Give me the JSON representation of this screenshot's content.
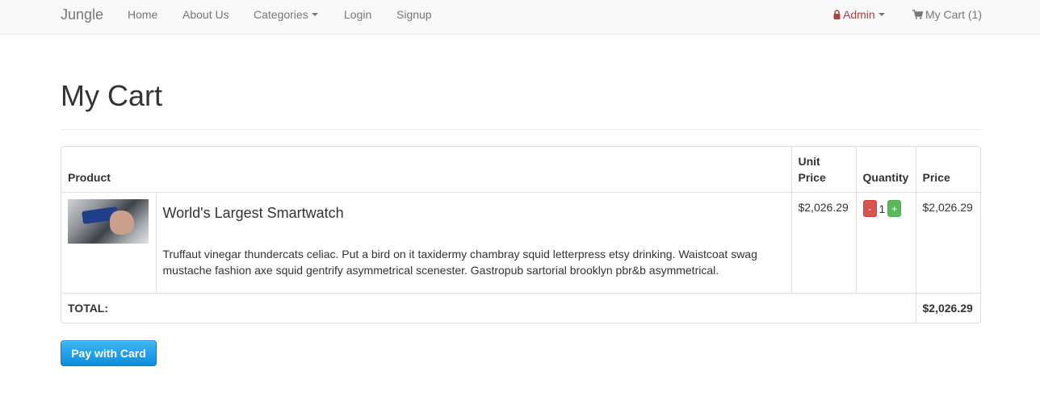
{
  "navbar": {
    "brand": "Jungle",
    "links": {
      "home": "Home",
      "about": "About Us",
      "categories": "Categories",
      "login": "Login",
      "signup": "Signup"
    },
    "admin_label": "Admin",
    "cart_label": "My Cart (1)"
  },
  "page": {
    "title": "My Cart"
  },
  "cart": {
    "headers": {
      "product": "Product",
      "unit_price_line1": "Unit",
      "unit_price_line2": "Price",
      "quantity": "Quantity",
      "price": "Price"
    },
    "items": [
      {
        "name": "World's Largest Smartwatch",
        "description": "Truffaut vinegar thundercats celiac. Put a bird on it taxidermy chambray squid letterpress etsy drinking. Waistcoat swag mustache fashion axe squid gentrify asymmetrical scenester. Gastropub sartorial brooklyn pbr&b asymmetrical.",
        "unit_price": "$2,026.29",
        "quantity": "1",
        "minus_label": "-",
        "plus_label": "+",
        "price": "$2,026.29"
      }
    ],
    "total_label": "TOTAL:",
    "total_value": "$2,026.29"
  },
  "pay_button": "Pay with Card",
  "colors": {
    "navbar_bg": "#f8f8f8",
    "admin": "#a94442",
    "minus_btn": "#d9534f",
    "plus_btn": "#5cb85c",
    "pay_btn": "#1a9ae8"
  },
  "icons": {
    "admin": "lock-icon",
    "cart": "shopping-cart-icon",
    "dropdown": "caret-down-icon"
  }
}
